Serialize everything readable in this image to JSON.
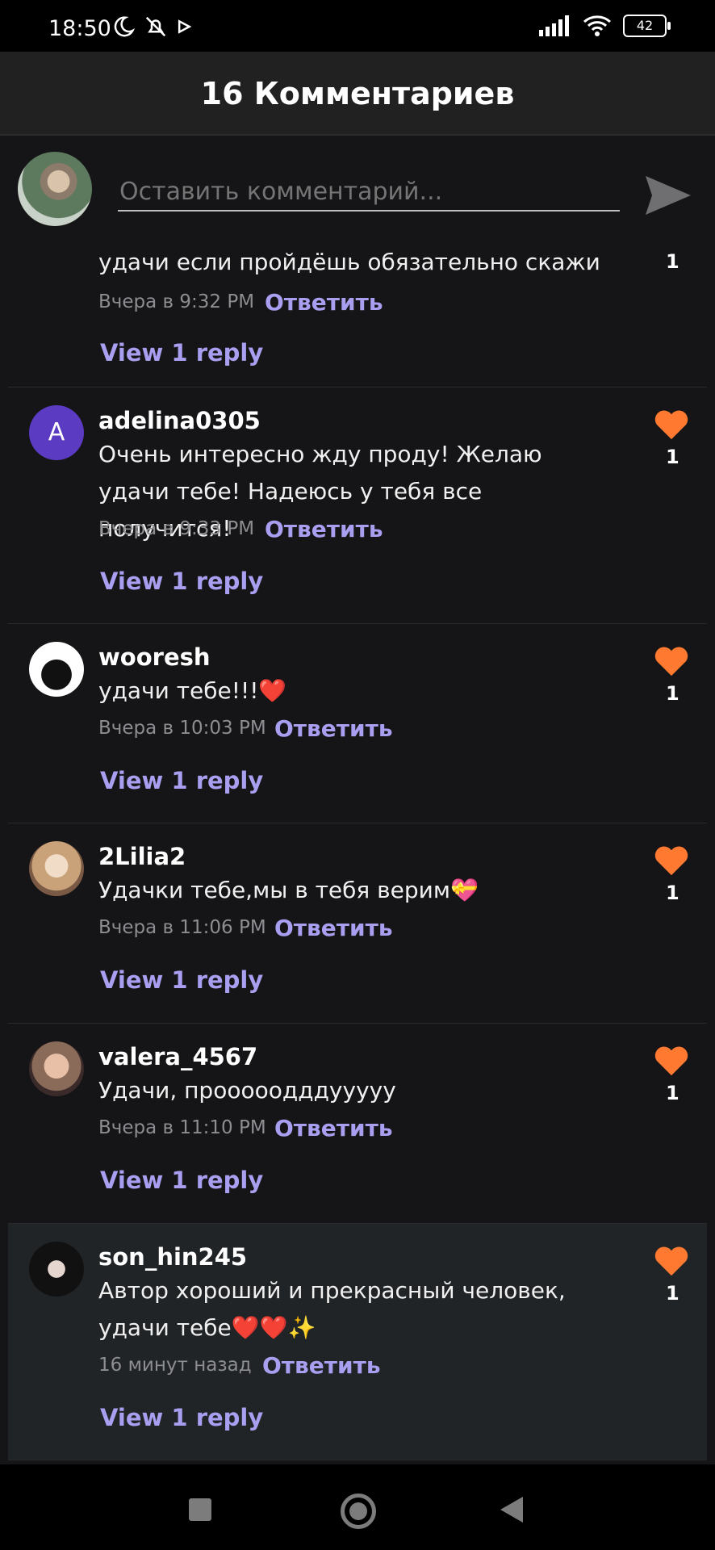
{
  "status_bar": {
    "time": "18:50",
    "battery": "42"
  },
  "header": {
    "title": "16 Комментариев"
  },
  "composer": {
    "placeholder": "Оставить комментарий..."
  },
  "colors": {
    "accent": "#a99ff0",
    "heart": "#ff7a30",
    "background": "#151416"
  },
  "comments": [
    {
      "username": "",
      "text": "удачи если пройдёшь обязательно скажи",
      "time": "Вчера в 9:32 PM",
      "reply_label": "Ответить",
      "view_replies": "View 1 reply",
      "likes": "1"
    },
    {
      "username": "adelina0305",
      "avatar_letter": "A",
      "text": "Очень интересно жду проду! Желаю удачи тебе! Надеюсь у тебя все получится!",
      "time": "Вчера в 9:33 PM",
      "reply_label": "Ответить",
      "view_replies": "View 1 reply",
      "likes": "1"
    },
    {
      "username": "wooresh",
      "text": "удачи тебе!!!❤️",
      "time": "Вчера в 10:03 PM",
      "reply_label": "Ответить",
      "view_replies": "View 1 reply",
      "likes": "1"
    },
    {
      "username": "2Lilia2",
      "text": "Удачки тебе,мы в тебя верим💝",
      "time": "Вчера в 11:06 PM",
      "reply_label": "Ответить",
      "view_replies": "View 1 reply",
      "likes": "1"
    },
    {
      "username": "valera_4567",
      "text": "Удачи, прооооодддууууу",
      "time": "Вчера в 11:10 PM",
      "reply_label": "Ответить",
      "view_replies": "View 1 reply",
      "likes": "1"
    },
    {
      "username": "son_hin245",
      "text": "Автор хороший и прекрасный человек, удачи тебе❤️❤️✨",
      "time": "16 минут назад",
      "reply_label": "Ответить",
      "view_replies": "View 1 reply",
      "likes": "1"
    }
  ]
}
